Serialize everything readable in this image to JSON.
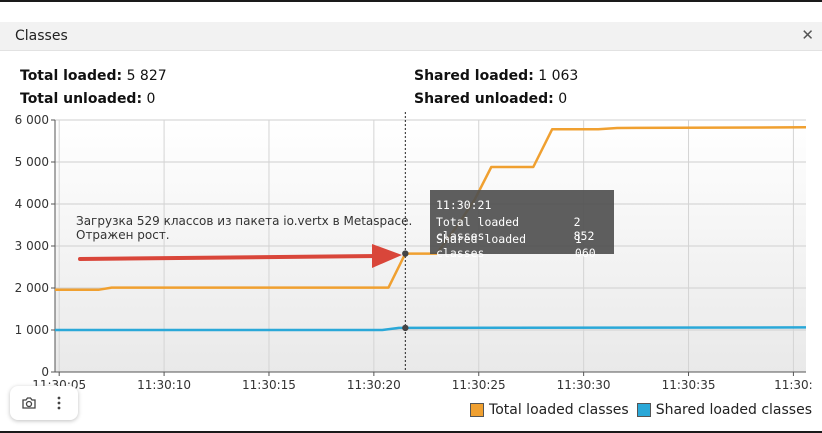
{
  "window": {
    "title": "Classes",
    "close_icon": "close-icon"
  },
  "stats": {
    "total_loaded_label": "Total loaded:",
    "total_loaded_value": "5 827",
    "total_unloaded_label": "Total unloaded:",
    "total_unloaded_value": "0",
    "shared_loaded_label": "Shared loaded:",
    "shared_loaded_value": "1 063",
    "shared_unloaded_label": "Shared unloaded:",
    "shared_unloaded_value": "0"
  },
  "annotation": {
    "line1": "Загрузка 529 классов из пакета io.vertx в Metaspace.",
    "line2": "Отражен рост."
  },
  "tooltip": {
    "time": "11:30:21",
    "rows": [
      {
        "label": "Total loaded classes",
        "value": "2 852"
      },
      {
        "label": "Shared loaded classes",
        "value": "1 060"
      }
    ]
  },
  "legend": [
    {
      "name": "Total loaded classes",
      "color": "#f0a030"
    },
    {
      "name": "Shared loaded classes",
      "color": "#2aa8d8"
    }
  ],
  "toolbar": {
    "camera_icon": "camera-icon",
    "more_icon": "more-vertical-icon"
  },
  "chart_data": {
    "type": "line",
    "y_ticks": [
      "0",
      "1 000",
      "2 000",
      "3 000",
      "4 000",
      "5 000",
      "6 000"
    ],
    "x_ticks": [
      "11:30:05",
      "11:30:10",
      "11:30:15",
      "11:30:20",
      "11:30:25",
      "11:30:30",
      "11:30:35",
      "11:30:"
    ],
    "ylim": [
      0,
      6000
    ],
    "xlim_seconds": [
      4.8,
      40.6
    ],
    "series": [
      {
        "name": "Total loaded classes",
        "color": "#f0a030",
        "points": [
          [
            4.8,
            1960
          ],
          [
            6.9,
            1960
          ],
          [
            7.5,
            2010
          ],
          [
            20.7,
            2010
          ],
          [
            21.5,
            2820
          ],
          [
            23.0,
            2820
          ],
          [
            24.0,
            3500
          ],
          [
            24.8,
            4100
          ],
          [
            25.6,
            4880
          ],
          [
            27.6,
            4880
          ],
          [
            28.5,
            5780
          ],
          [
            30.7,
            5780
          ],
          [
            31.6,
            5810
          ],
          [
            40.6,
            5827
          ]
        ]
      },
      {
        "name": "Shared loaded classes",
        "color": "#2aa8d8",
        "points": [
          [
            4.8,
            1000
          ],
          [
            20.4,
            1000
          ],
          [
            21.2,
            1050
          ],
          [
            40.6,
            1063
          ]
        ]
      }
    ],
    "cursor_x_seconds": 21.5,
    "markers": [
      [
        21.5,
        2820
      ],
      [
        21.5,
        1050
      ]
    ],
    "grid": true,
    "legend_position": "bottom-right"
  }
}
